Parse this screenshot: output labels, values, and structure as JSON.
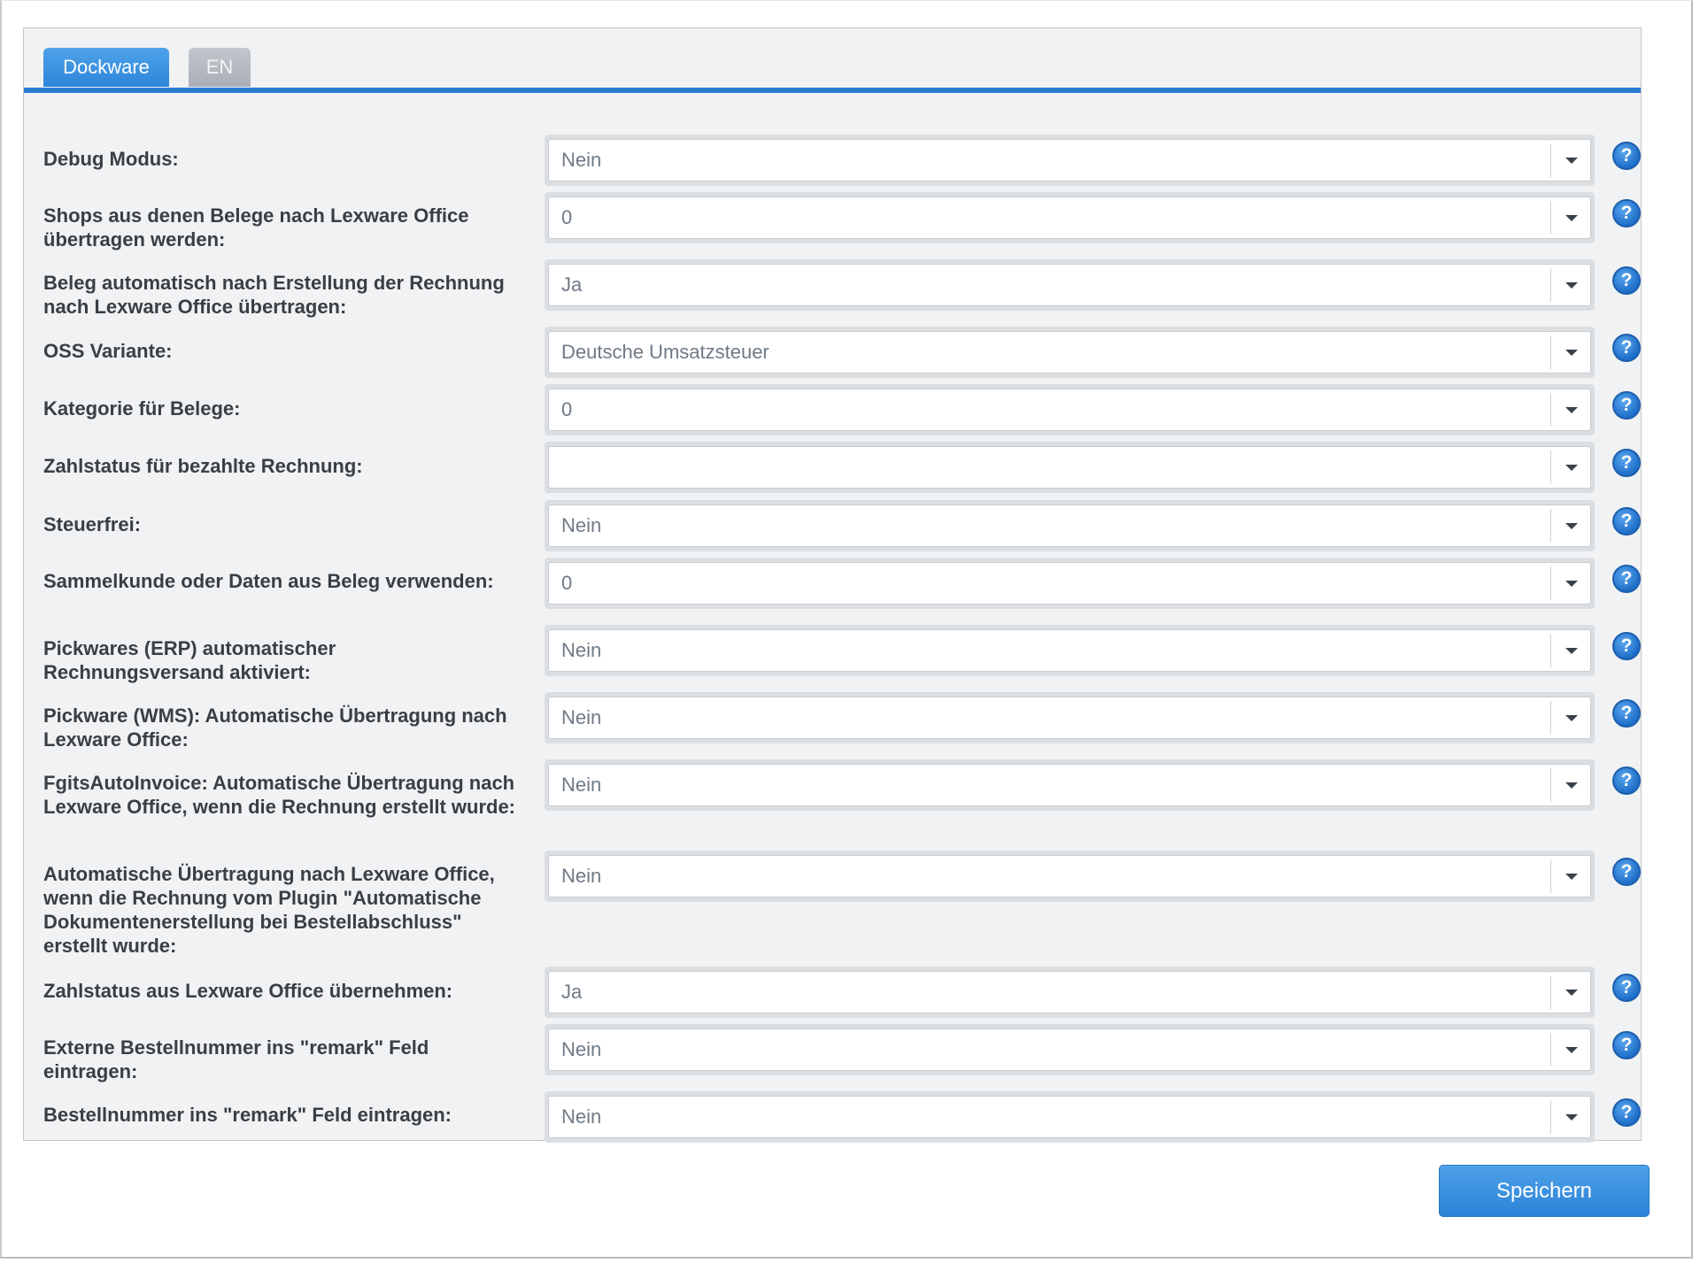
{
  "tabs": [
    {
      "label": "Dockware"
    },
    {
      "label": "EN"
    }
  ],
  "settings": [
    {
      "label": "Debug Modus:",
      "value": "Nein"
    },
    {
      "label": "Shops aus denen Belege nach Lexware Office übertragen werden:",
      "value": "0"
    },
    {
      "label": "Beleg automatisch nach Erstellung der Rechnung nach Lexware Office übertragen:",
      "value": "Ja"
    },
    {
      "label": "OSS Variante:",
      "value": "Deutsche Umsatzsteuer"
    },
    {
      "label": "Kategorie für Belege:",
      "value": "0"
    },
    {
      "label": "Zahlstatus für bezahlte Rechnung:",
      "value": ""
    },
    {
      "label": "Steuerfrei:",
      "value": "Nein"
    },
    {
      "label": "Sammelkunde oder Daten aus Beleg verwenden:",
      "value": "0"
    },
    {
      "label": "Pickwares (ERP) automatischer Rechnungsversand aktiviert:",
      "value": "Nein"
    },
    {
      "label": "Pickware (WMS): Automatische Übertragung nach Lexware Office:",
      "value": "Nein"
    },
    {
      "label": "FgitsAutoInvoice: Automatische Übertragung nach Lexware Office, wenn die Rechnung erstellt wurde:",
      "value": "Nein"
    },
    {
      "label": "Automatische Übertragung nach Lexware Office, wenn die Rechnung vom Plugin \"Automatische Dokumentenerstellung bei Bestellabschluss\" erstellt wurde:",
      "value": "Nein"
    },
    {
      "label": "Zahlstatus aus Lexware Office übernehmen:",
      "value": "Ja"
    },
    {
      "label": "Externe Bestellnummer ins \"remark\" Feld eintragen:",
      "value": "Nein"
    },
    {
      "label": "Bestellnummer ins \"remark\" Feld eintragen:",
      "value": "Nein"
    }
  ],
  "help_icon_glyph": "?",
  "save_label": "Speichern",
  "colors": {
    "accent": "#2b7bd3",
    "panel_bg": "#f1f2f3"
  }
}
